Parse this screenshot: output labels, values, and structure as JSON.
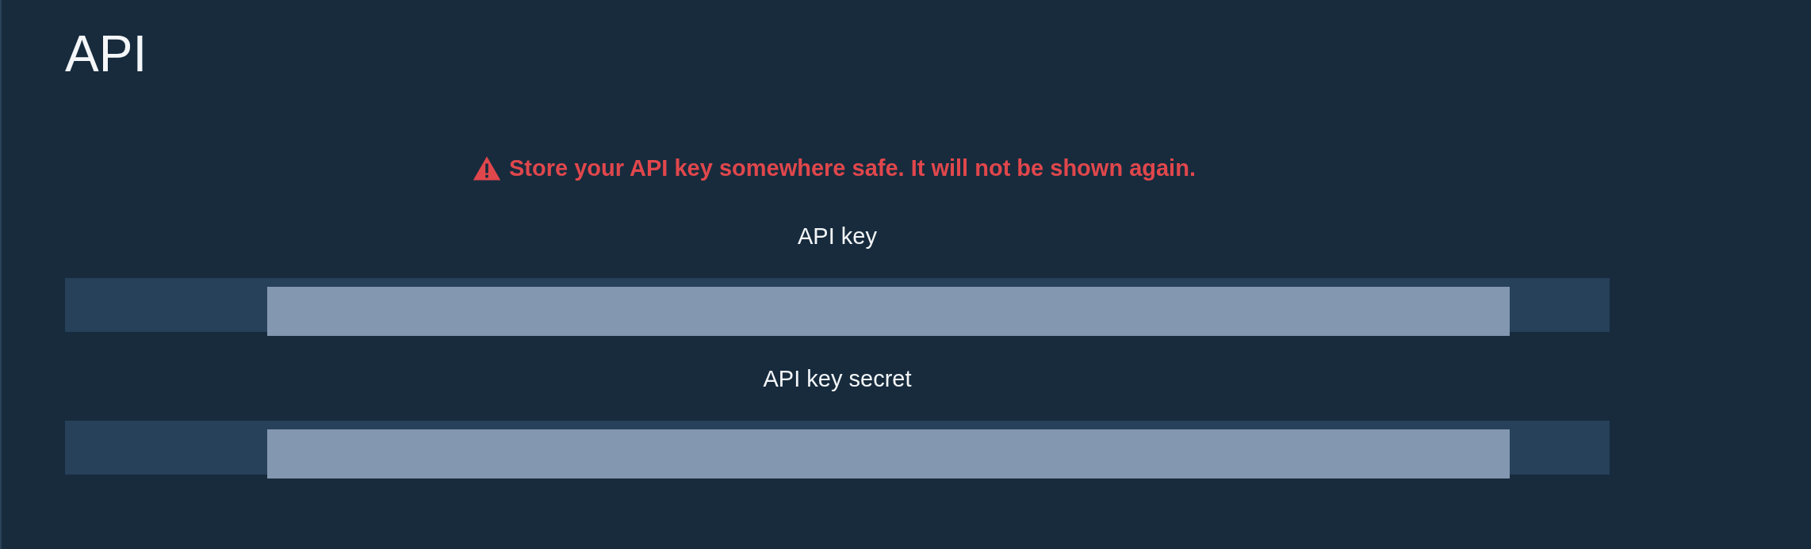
{
  "page": {
    "title": "API"
  },
  "warning": {
    "text": "Store your API key somewhere safe. It will not be shown again."
  },
  "fields": [
    {
      "label": "API key",
      "redacted": true
    },
    {
      "label": "API key secret",
      "redacted": true
    }
  ]
}
